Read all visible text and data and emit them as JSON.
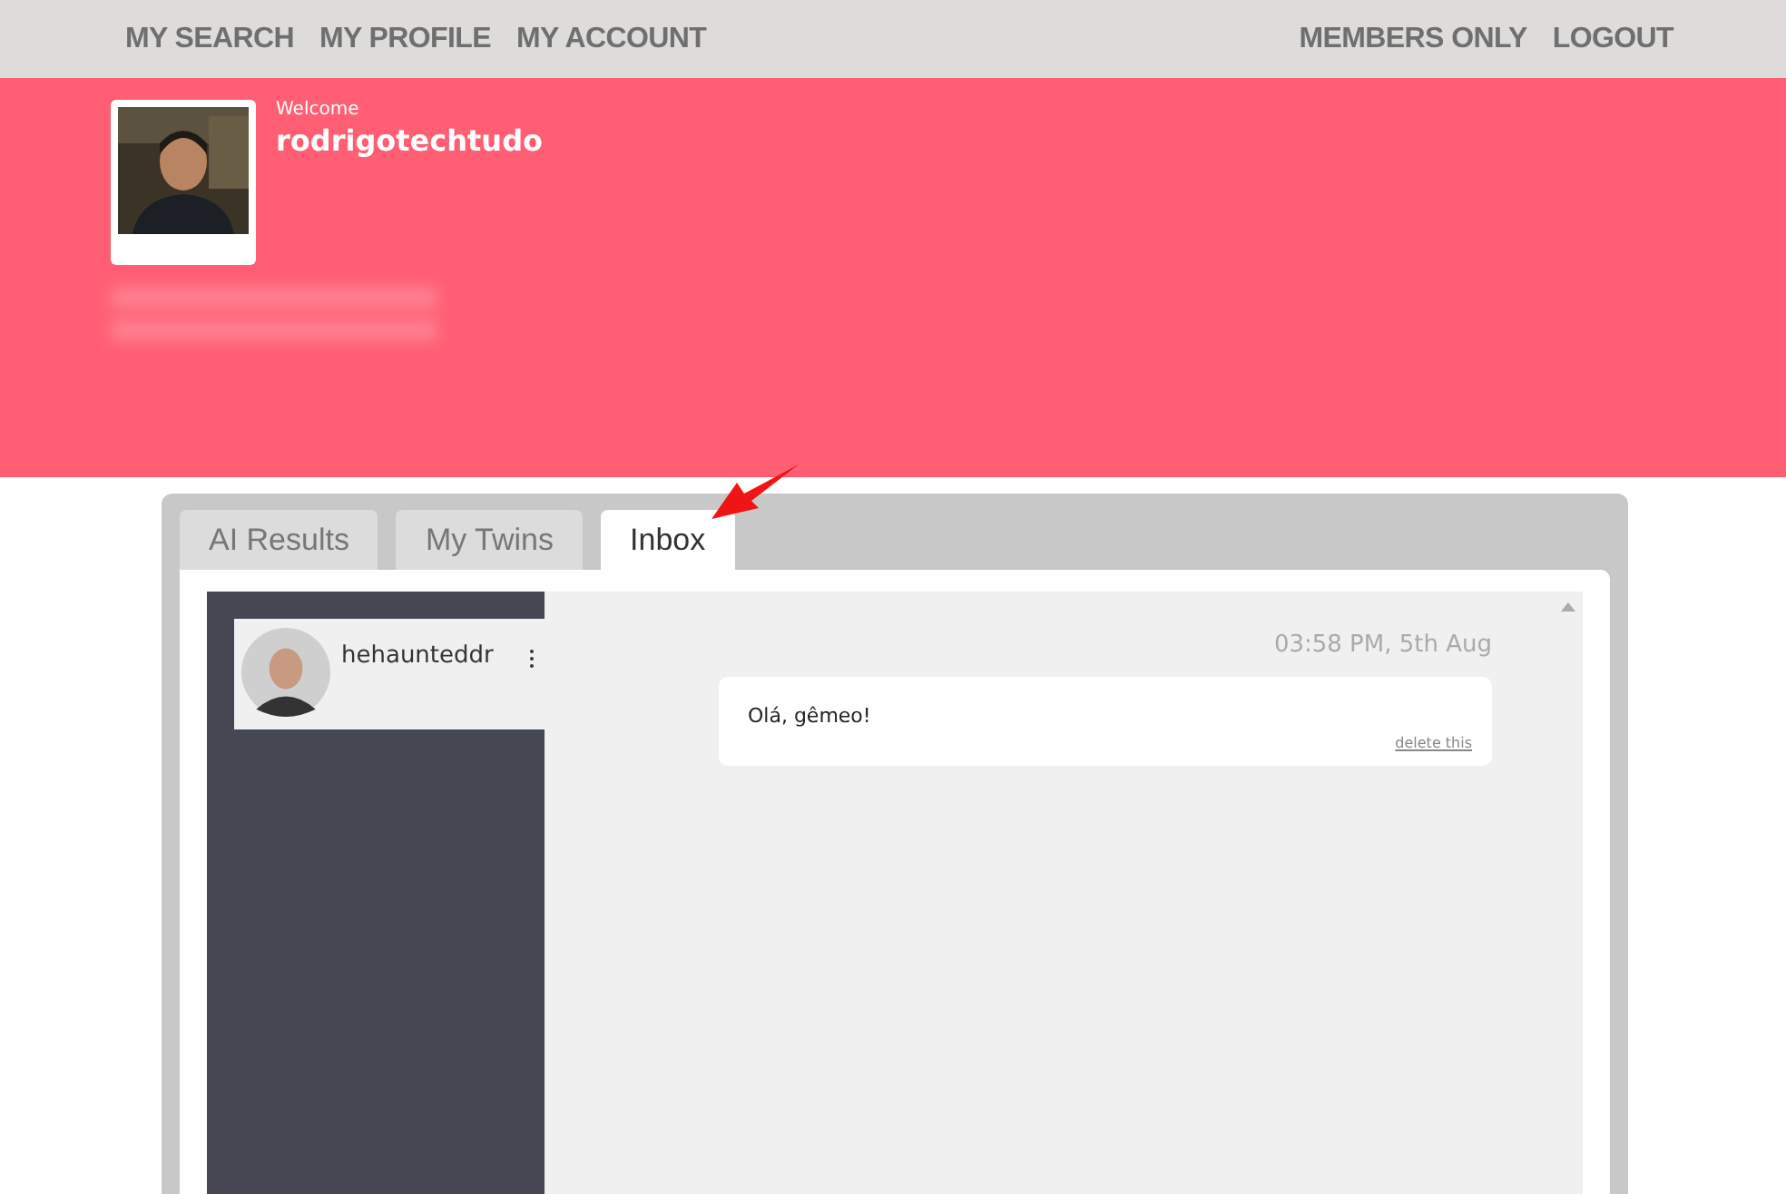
{
  "nav": {
    "left": [
      "MY SEARCH",
      "MY PROFILE",
      "MY ACCOUNT"
    ],
    "right": [
      "MEMBERS ONLY",
      "LOGOUT"
    ]
  },
  "profile": {
    "welcome": "Welcome",
    "username": "rodrigotechtudo"
  },
  "tabs": [
    {
      "label": "AI Results",
      "selected": false
    },
    {
      "label": "My Twins",
      "selected": false
    },
    {
      "label": "Inbox",
      "selected": true
    }
  ],
  "conversations": [
    {
      "name": "hehaunteddr",
      "selected": true
    }
  ],
  "messages": [
    {
      "time": "03:58 PM, 5th Aug",
      "text": "Olá, gêmeo!",
      "action": "delete this"
    }
  ]
}
